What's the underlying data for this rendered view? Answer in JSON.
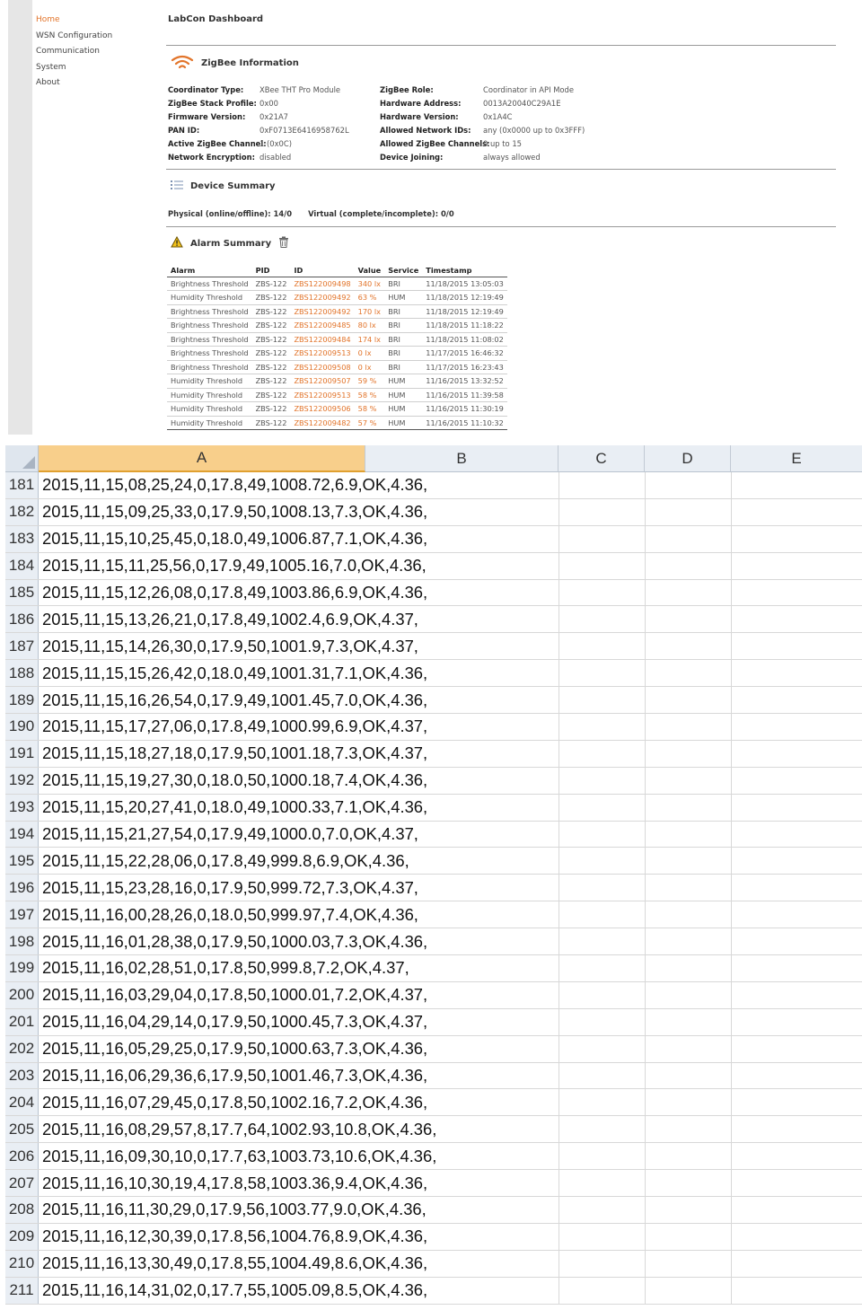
{
  "nav": {
    "items": [
      "Home",
      "WSN Configuration",
      "Communication",
      "System",
      "About"
    ]
  },
  "app_title": "LabCon Dashboard",
  "zigbee": {
    "title": "ZigBee Information",
    "left": [
      {
        "k": "Coordinator Type:",
        "v": "XBee THT Pro Module"
      },
      {
        "k": "ZigBee Stack Profile:",
        "v": "0x00"
      },
      {
        "k": "Firmware Version:",
        "v": "0x21A7"
      },
      {
        "k": "PAN ID:",
        "v": "0xF0713E6416958762L"
      },
      {
        "k": "Active ZigBee Channel:",
        "v": "1 (0x0C)"
      },
      {
        "k": "Network Encryption:",
        "v": "disabled"
      }
    ],
    "right": [
      {
        "k": "ZigBee Role:",
        "v": "Coordinator in API Mode"
      },
      {
        "k": "Hardware Address:",
        "v": "0013A20040C29A1E"
      },
      {
        "k": "Hardware Version:",
        "v": "0x1A4C"
      },
      {
        "k": "Allowed Network IDs:",
        "v": "any (0x0000 up to 0x3FFF)"
      },
      {
        "k": "Allowed ZigBee Channels:",
        "v": "0 up to 15"
      },
      {
        "k": "Device Joining:",
        "v": "always allowed"
      }
    ]
  },
  "device_summary": {
    "title": "Device Summary",
    "physical": "Physical (online/offline): 14/0",
    "virtual": "Virtual (complete/incomplete): 0/0"
  },
  "alarm_summary": {
    "title": "Alarm Summary",
    "columns": [
      "Alarm",
      "PID",
      "ID",
      "Value",
      "Service",
      "Timestamp"
    ],
    "rows": [
      [
        "Brightness Threshold",
        "ZBS-122",
        "ZBS122009498",
        "340 lx",
        "BRI",
        "11/18/2015 13:05:03"
      ],
      [
        "Humidity Threshold",
        "ZBS-122",
        "ZBS122009492",
        "63 %",
        "HUM",
        "11/18/2015 12:19:49"
      ],
      [
        "Brightness Threshold",
        "ZBS-122",
        "ZBS122009492",
        "170 lx",
        "BRI",
        "11/18/2015 12:19:49"
      ],
      [
        "Brightness Threshold",
        "ZBS-122",
        "ZBS122009485",
        "80 lx",
        "BRI",
        "11/18/2015 11:18:22"
      ],
      [
        "Brightness Threshold",
        "ZBS-122",
        "ZBS122009484",
        "174 lx",
        "BRI",
        "11/18/2015 11:08:02"
      ],
      [
        "Brightness Threshold",
        "ZBS-122",
        "ZBS122009513",
        "0 lx",
        "BRI",
        "11/17/2015 16:46:32"
      ],
      [
        "Brightness Threshold",
        "ZBS-122",
        "ZBS122009508",
        "0 lx",
        "BRI",
        "11/17/2015 16:23:43"
      ],
      [
        "Humidity Threshold",
        "ZBS-122",
        "ZBS122009507",
        "59 %",
        "HUM",
        "11/16/2015 13:32:52"
      ],
      [
        "Humidity Threshold",
        "ZBS-122",
        "ZBS122009513",
        "58 %",
        "HUM",
        "11/16/2015 11:39:58"
      ],
      [
        "Humidity Threshold",
        "ZBS-122",
        "ZBS122009506",
        "58 %",
        "HUM",
        "11/16/2015 11:30:19"
      ],
      [
        "Humidity Threshold",
        "ZBS-122",
        "ZBS122009482",
        "57 %",
        "HUM",
        "11/16/2015 11:10:32"
      ]
    ]
  },
  "sheet": {
    "columns": [
      "A",
      "B",
      "C",
      "D",
      "E"
    ],
    "selected_column": "A",
    "rows": [
      {
        "n": "181",
        "a": "2015,11,15,08,25,24,0,17.8,49,1008.72,6.9,OK,4.36,"
      },
      {
        "n": "182",
        "a": "2015,11,15,09,25,33,0,17.9,50,1008.13,7.3,OK,4.36,"
      },
      {
        "n": "183",
        "a": "2015,11,15,10,25,45,0,18.0,49,1006.87,7.1,OK,4.36,"
      },
      {
        "n": "184",
        "a": "2015,11,15,11,25,56,0,17.9,49,1005.16,7.0,OK,4.36,"
      },
      {
        "n": "185",
        "a": "2015,11,15,12,26,08,0,17.8,49,1003.86,6.9,OK,4.36,"
      },
      {
        "n": "186",
        "a": "2015,11,15,13,26,21,0,17.8,49,1002.4,6.9,OK,4.37,"
      },
      {
        "n": "187",
        "a": "2015,11,15,14,26,30,0,17.9,50,1001.9,7.3,OK,4.37,"
      },
      {
        "n": "188",
        "a": "2015,11,15,15,26,42,0,18.0,49,1001.31,7.1,OK,4.36,"
      },
      {
        "n": "189",
        "a": "2015,11,15,16,26,54,0,17.9,49,1001.45,7.0,OK,4.36,"
      },
      {
        "n": "190",
        "a": "2015,11,15,17,27,06,0,17.8,49,1000.99,6.9,OK,4.37,"
      },
      {
        "n": "191",
        "a": "2015,11,15,18,27,18,0,17.9,50,1001.18,7.3,OK,4.37,"
      },
      {
        "n": "192",
        "a": "2015,11,15,19,27,30,0,18.0,50,1000.18,7.4,OK,4.36,"
      },
      {
        "n": "193",
        "a": "2015,11,15,20,27,41,0,18.0,49,1000.33,7.1,OK,4.36,"
      },
      {
        "n": "194",
        "a": "2015,11,15,21,27,54,0,17.9,49,1000.0,7.0,OK,4.37,"
      },
      {
        "n": "195",
        "a": "2015,11,15,22,28,06,0,17.8,49,999.8,6.9,OK,4.36,"
      },
      {
        "n": "196",
        "a": "2015,11,15,23,28,16,0,17.9,50,999.72,7.3,OK,4.37,"
      },
      {
        "n": "197",
        "a": "2015,11,16,00,28,26,0,18.0,50,999.97,7.4,OK,4.36,"
      },
      {
        "n": "198",
        "a": "2015,11,16,01,28,38,0,17.9,50,1000.03,7.3,OK,4.36,"
      },
      {
        "n": "199",
        "a": "2015,11,16,02,28,51,0,17.8,50,999.8,7.2,OK,4.37,"
      },
      {
        "n": "200",
        "a": "2015,11,16,03,29,04,0,17.8,50,1000.01,7.2,OK,4.37,"
      },
      {
        "n": "201",
        "a": "2015,11,16,04,29,14,0,17.9,50,1000.45,7.3,OK,4.37,"
      },
      {
        "n": "202",
        "a": "2015,11,16,05,29,25,0,17.9,50,1000.63,7.3,OK,4.36,"
      },
      {
        "n": "203",
        "a": "2015,11,16,06,29,36,6,17.9,50,1001.46,7.3,OK,4.36,"
      },
      {
        "n": "204",
        "a": "2015,11,16,07,29,45,0,17.8,50,1002.16,7.2,OK,4.36,"
      },
      {
        "n": "205",
        "a": "2015,11,16,08,29,57,8,17.7,64,1002.93,10.8,OK,4.36,"
      },
      {
        "n": "206",
        "a": "2015,11,16,09,30,10,0,17.7,63,1003.73,10.6,OK,4.36,"
      },
      {
        "n": "207",
        "a": "2015,11,16,10,30,19,4,17.8,58,1003.36,9.4,OK,4.36,"
      },
      {
        "n": "208",
        "a": "2015,11,16,11,30,29,0,17.9,56,1003.77,9.0,OK,4.36,"
      },
      {
        "n": "209",
        "a": "2015,11,16,12,30,39,0,17.8,56,1004.76,8.9,OK,4.36,"
      },
      {
        "n": "210",
        "a": "2015,11,16,13,30,49,0,17.8,55,1004.49,8.6,OK,4.36,"
      },
      {
        "n": "211",
        "a": "2015,11,16,14,31,02,0,17.7,55,1005.09,8.5,OK,4.36,"
      }
    ]
  },
  "colors": {
    "accent": "#e2742a",
    "selected_header": "#f8cf8b",
    "header_bg": "#e9eef4"
  }
}
